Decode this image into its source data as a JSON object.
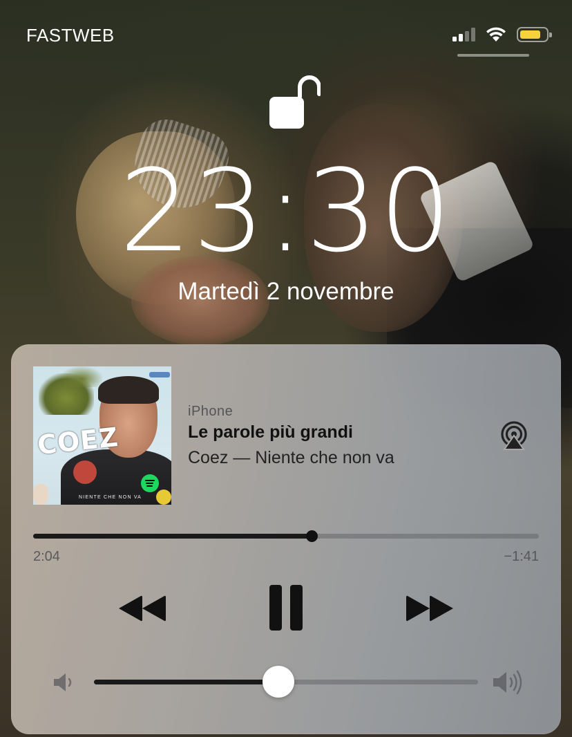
{
  "status_bar": {
    "carrier": "FASTWEB",
    "signal_bars_filled": 2,
    "signal_bars_total": 4,
    "wifi_icon": "wifi-icon",
    "battery_level": 0.8,
    "battery_color": "#f6d33a"
  },
  "lock_screen": {
    "lock_icon": "unlocked-padlock-icon",
    "time": "23:30",
    "date": "Martedì 2 novembre"
  },
  "now_playing": {
    "source": "iPhone",
    "title": "Le parole più grandi",
    "artist_album": "Coez — Niente che non va",
    "artwork": {
      "artist_text": "COEZ",
      "caption": "NIENTE CHE NON VA"
    },
    "airplay_icon": "airplay-icon",
    "elapsed": "2:04",
    "remaining": "−1:41",
    "progress": 0.55,
    "controls": {
      "rewind_icon": "rewind-icon",
      "pause_icon": "pause-icon",
      "forward_icon": "fast-forward-icon"
    },
    "volume": {
      "level": 0.48,
      "low_icon": "volume-low-icon",
      "high_icon": "volume-high-icon"
    }
  }
}
